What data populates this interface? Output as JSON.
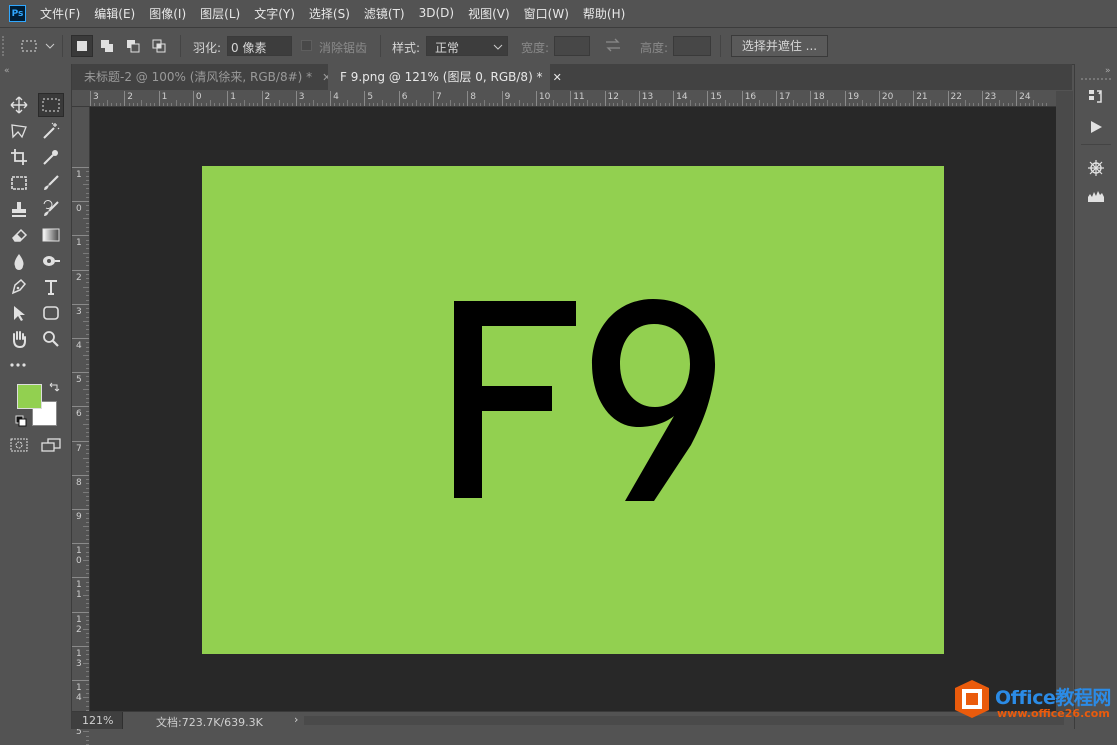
{
  "app": {
    "logo_text": "Ps"
  },
  "menu": [
    "文件(F)",
    "编辑(E)",
    "图像(I)",
    "图层(L)",
    "文字(Y)",
    "选择(S)",
    "滤镜(T)",
    "3D(D)",
    "视图(V)",
    "窗口(W)",
    "帮助(H)"
  ],
  "options": {
    "feather_label": "羽化:",
    "feather_value": "0 像素",
    "antialias_label": "消除锯齿",
    "style_label": "样式:",
    "style_value": "正常",
    "width_label": "宽度:",
    "height_label": "高度:",
    "select_mask_button": "选择并遮住 ..."
  },
  "tabs": [
    {
      "label": "未标题-2 @ 100% (清风徐来, RGB/8#) *",
      "active": false
    },
    {
      "label": "F 9.png @ 121% (图层 0, RGB/8) *",
      "active": true
    }
  ],
  "ruler": {
    "top_labels": [
      "3",
      "2",
      "1",
      "0",
      "1",
      "2",
      "3",
      "4",
      "5",
      "6",
      "7",
      "8",
      "9",
      "10",
      "11",
      "12",
      "13",
      "14",
      "15",
      "16",
      "17",
      "18",
      "19",
      "20",
      "21",
      "22",
      "23",
      "24"
    ],
    "left_labels": [
      "1",
      "0",
      "1",
      "2",
      "3",
      "4",
      "5",
      "6",
      "7",
      "8",
      "9",
      "10",
      "11",
      "12",
      "13",
      "14",
      "15"
    ]
  },
  "document": {
    "text": "F9",
    "background_color": "#92d050",
    "text_color": "#000000"
  },
  "colors": {
    "foreground": "#92d050",
    "background": "#ffffff"
  },
  "status": {
    "zoom": "121%",
    "doc_size": "文档:723.7K/639.3K",
    "arrow": "›"
  },
  "watermark": {
    "brand": "Office教程网",
    "url": "www.office26.com"
  }
}
